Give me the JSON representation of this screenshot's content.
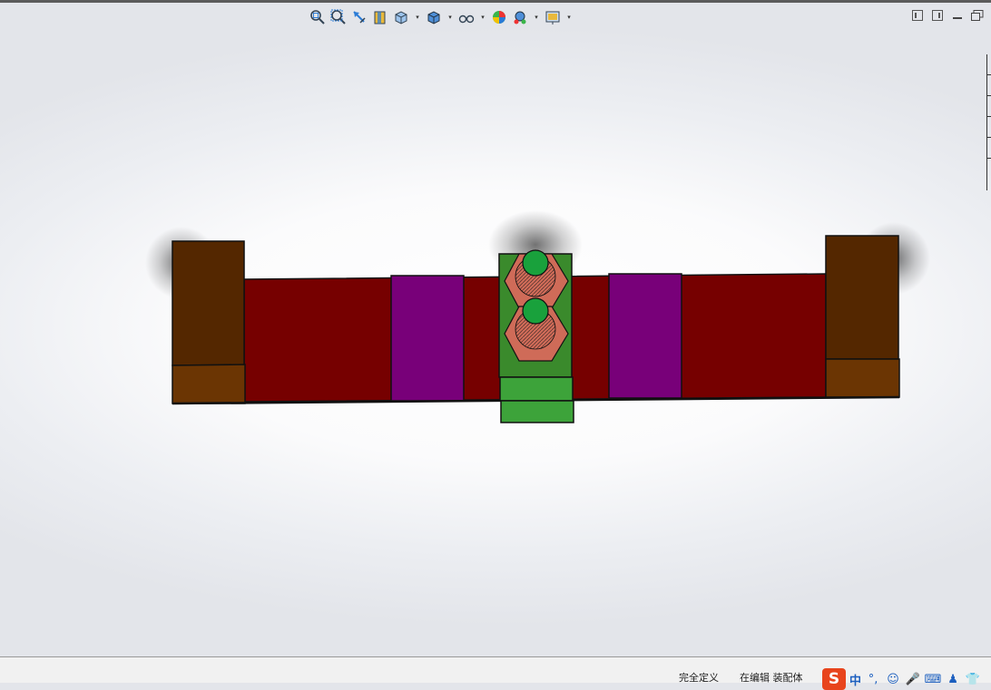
{
  "hud": {
    "buttons": [
      {
        "name": "zoom-to-fit-icon"
      },
      {
        "name": "zoom-to-area-icon"
      },
      {
        "name": "previous-view-icon"
      },
      {
        "name": "section-view-icon"
      },
      {
        "name": "view-orientation-icon",
        "dropdown": true
      },
      {
        "name": "display-style-icon",
        "dropdown": true
      },
      {
        "name": "hide-show-items-icon",
        "dropdown": true
      },
      {
        "name": "edit-appearance-icon"
      },
      {
        "name": "apply-scene-icon",
        "dropdown": true
      },
      {
        "name": "view-settings-icon",
        "dropdown": true
      }
    ],
    "dropdown_glyph": "▾"
  },
  "window_controls": [
    "tile-horizontal-icon",
    "tile-vertical-icon",
    "minimize-icon",
    "restore-icon"
  ],
  "model": {
    "colors": {
      "brown_dark": "#542700",
      "brown_light": "#6b3503",
      "red": "#760000",
      "purple": "#780079",
      "green_dark": "#3a8a2c",
      "green_light": "#3da33a",
      "nut": "#cf6b58",
      "bolt": "#19a13c"
    }
  },
  "status": {
    "definition": "完全定义",
    "mode": "在编辑 装配体"
  },
  "ime": {
    "logo": "S",
    "lang": "中",
    "punct": "°,",
    "emoji": "☺",
    "mic": "🎤",
    "keyboard": "⌨",
    "user": "♟",
    "shirt": "👕"
  }
}
